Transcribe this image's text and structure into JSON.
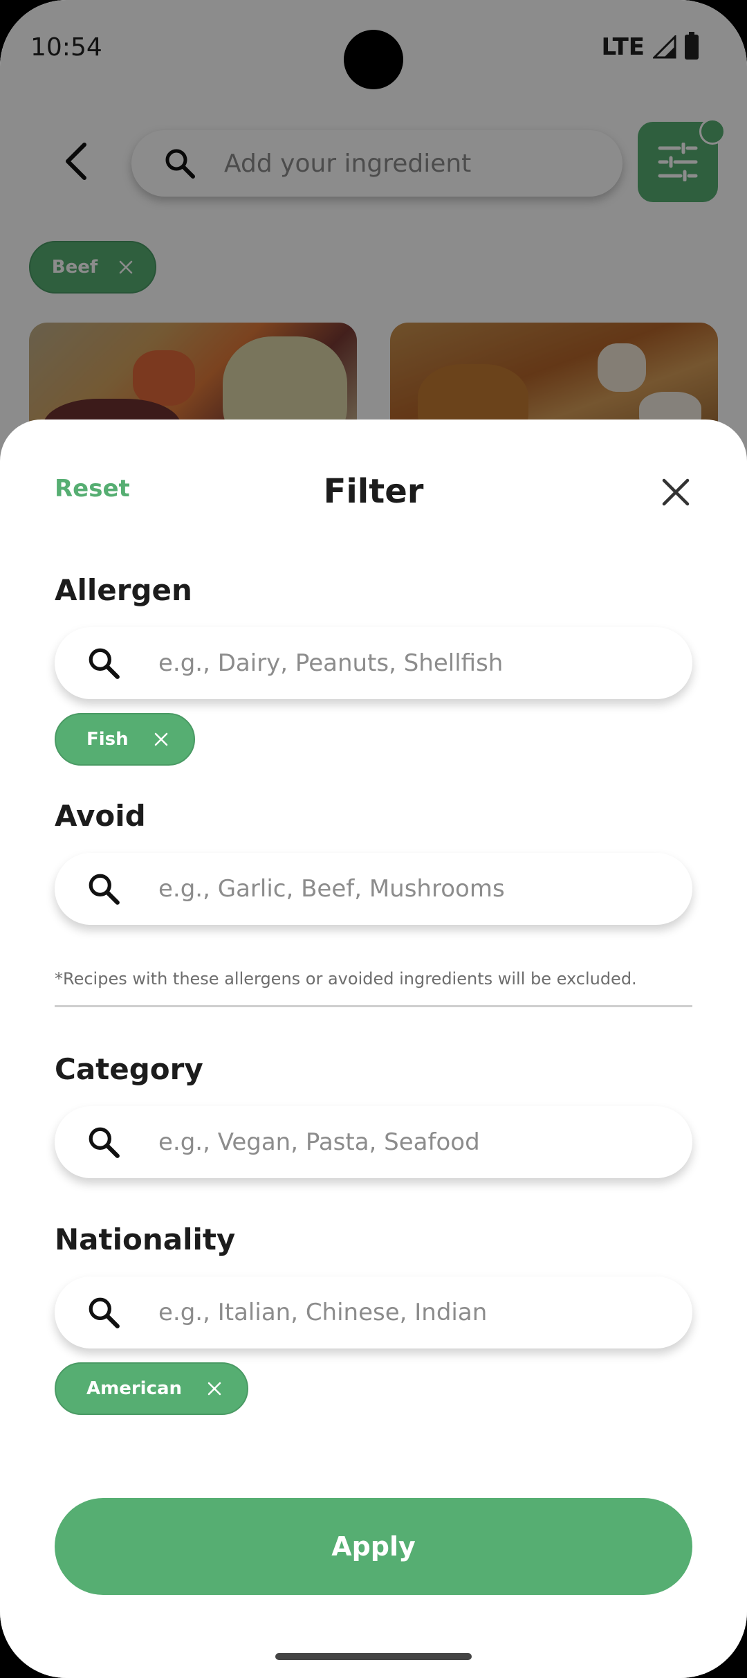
{
  "status_bar": {
    "time": "10:54",
    "network": "LTE"
  },
  "background": {
    "search_placeholder": "Add your ingredient",
    "ingredient_chip": "Beef"
  },
  "sheet": {
    "reset_label": "Reset",
    "title": "Filter",
    "sections": {
      "allergen": {
        "label": "Allergen",
        "placeholder": "e.g., Dairy, Peanuts, Shellfish",
        "chips": [
          "Fish"
        ]
      },
      "avoid": {
        "label": "Avoid",
        "placeholder": "e.g., Garlic, Beef, Mushrooms",
        "chips": []
      },
      "category": {
        "label": "Category",
        "placeholder": "e.g., Vegan, Pasta, Seafood",
        "chips": []
      },
      "nationality": {
        "label": "Nationality",
        "placeholder": "e.g., Italian, Chinese, Indian",
        "chips": [
          "American"
        ]
      }
    },
    "note": "*Recipes with these allergens or avoided ingredients will be excluded.",
    "apply_label": "Apply"
  },
  "colors": {
    "accent": "#56ae72",
    "scrim": "rgba(0,0,0,0.45)",
    "text": "#1c1c1c"
  },
  "icons": [
    "back-arrow-icon",
    "search-icon",
    "filter-sliders-icon",
    "close-icon",
    "chip-close-icon"
  ]
}
